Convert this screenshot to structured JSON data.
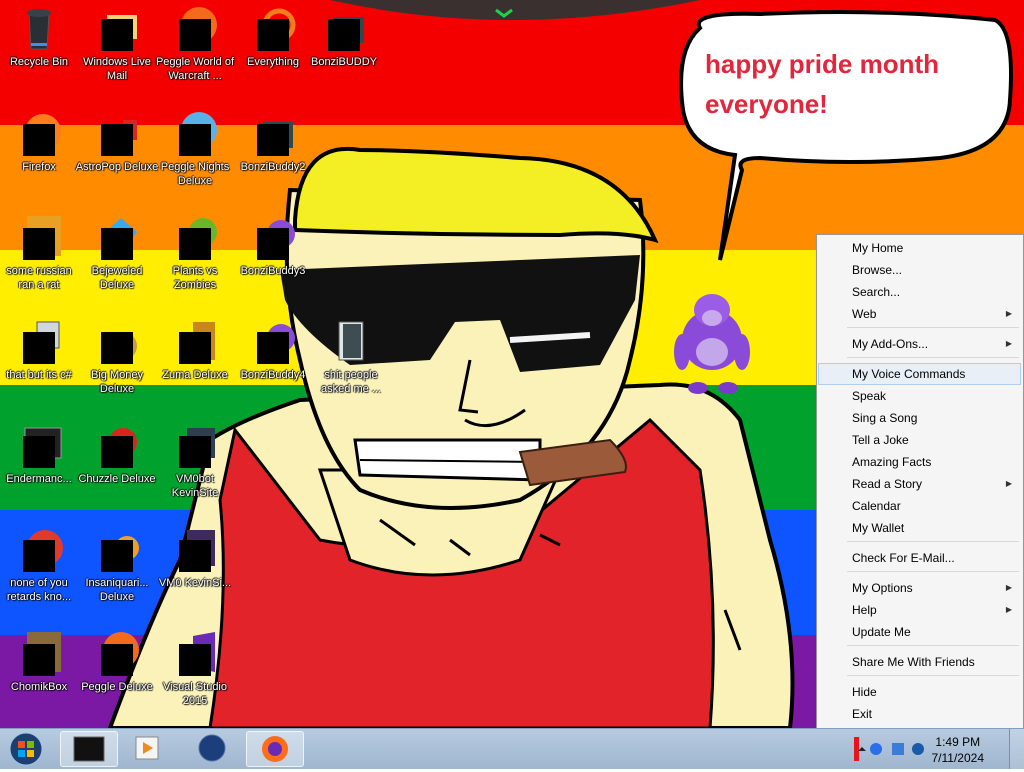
{
  "wallpaper": {
    "stripe_colors": [
      "#f50000",
      "#ff8b00",
      "#ffee00",
      "#00a12c",
      "#0e54ff",
      "#7b18a4"
    ],
    "speech_bubble_line1": "happy pride month",
    "speech_bubble_line2": "everyone!"
  },
  "desktop_icons": [
    {
      "label": "Recycle Bin",
      "icon": "recycle-bin-icon"
    },
    {
      "label": "Windows Live Mail",
      "icon": "mail-icon"
    },
    {
      "label": "Peggle World of Warcraft ...",
      "icon": "peggle-icon"
    },
    {
      "label": "Everything",
      "icon": "search-app-icon"
    },
    {
      "label": "BonziBUDDY",
      "icon": "folder-icon"
    },
    {
      "label": "Firefox",
      "icon": "firefox-icon"
    },
    {
      "label": "AstroPop Deluxe",
      "icon": "game-icon"
    },
    {
      "label": "Peggle Nights Deluxe",
      "icon": "peggle-icon"
    },
    {
      "label": "BonziBuddy2",
      "icon": "folder-icon"
    },
    {
      "label": "some russian ran a rat",
      "icon": "app-icon"
    },
    {
      "label": "Bejeweled Deluxe",
      "icon": "gem-icon"
    },
    {
      "label": "Plants vs Zombies",
      "icon": "plant-icon"
    },
    {
      "label": "BonziBuddy3",
      "icon": "bonzi-icon"
    },
    {
      "label": "that but its c#",
      "icon": "folder-stack-icon"
    },
    {
      "label": "Big Money Deluxe",
      "icon": "money-bag-icon"
    },
    {
      "label": "Zuma Deluxe",
      "icon": "zuma-icon"
    },
    {
      "label": "BonziBuddy4",
      "icon": "bonzi-icon"
    },
    {
      "label": "shit people asked me ...",
      "icon": "folder-icon"
    },
    {
      "label": "Endermanc...",
      "icon": "terminal-icon"
    },
    {
      "label": "Chuzzle Deluxe",
      "icon": "chuzzle-icon"
    },
    {
      "label": "VM0bot KevinSite",
      "icon": "vm-icon"
    },
    {
      "label": "none of you retards kno...",
      "icon": "chrome-icon"
    },
    {
      "label": "Insaniquari... Deluxe",
      "icon": "fish-icon"
    },
    {
      "label": "VM0 KevinSi...",
      "icon": "vm-icon"
    },
    {
      "label": "ChomikBox",
      "icon": "chomikbox-icon"
    },
    {
      "label": "Peggle Deluxe",
      "icon": "peggle-icon"
    },
    {
      "label": "Visual Studio 2015",
      "icon": "visual-studio-icon"
    }
  ],
  "context_menu": {
    "items": [
      {
        "label": "My Home",
        "submenu": false
      },
      {
        "label": "Browse...",
        "submenu": false
      },
      {
        "label": "Search...",
        "submenu": false
      },
      {
        "label": "Web",
        "submenu": true
      },
      {
        "label": "My Add-Ons...",
        "submenu": true
      },
      {
        "label": "My Voice Commands",
        "submenu": false,
        "highlighted": true
      },
      {
        "label": "Speak",
        "submenu": false
      },
      {
        "label": "Sing a Song",
        "submenu": false
      },
      {
        "label": "Tell a Joke",
        "submenu": false
      },
      {
        "label": "Amazing Facts",
        "submenu": false
      },
      {
        "label": "Read a Story",
        "submenu": true
      },
      {
        "label": "Calendar",
        "submenu": false
      },
      {
        "label": "My Wallet",
        "submenu": false
      },
      {
        "label": "Check For E-Mail...",
        "submenu": false
      },
      {
        "label": "My Options",
        "submenu": true
      },
      {
        "label": "Help",
        "submenu": true
      },
      {
        "label": "Update Me",
        "submenu": false
      },
      {
        "label": "Share Me With Friends",
        "submenu": false
      },
      {
        "label": "Hide",
        "submenu": false
      },
      {
        "label": "Exit",
        "submenu": false
      }
    ]
  },
  "taskbar": {
    "start_icon": "windows-start-icon",
    "pinned": [
      {
        "icon": "terminal-window-icon",
        "active": true
      },
      {
        "icon": "media-player-icon",
        "active": false
      },
      {
        "icon": "globe-icon",
        "active": false
      },
      {
        "icon": "firefox-icon",
        "active": true
      }
    ],
    "clock_time": "1:49 PM",
    "clock_date": "7/11/2024"
  }
}
